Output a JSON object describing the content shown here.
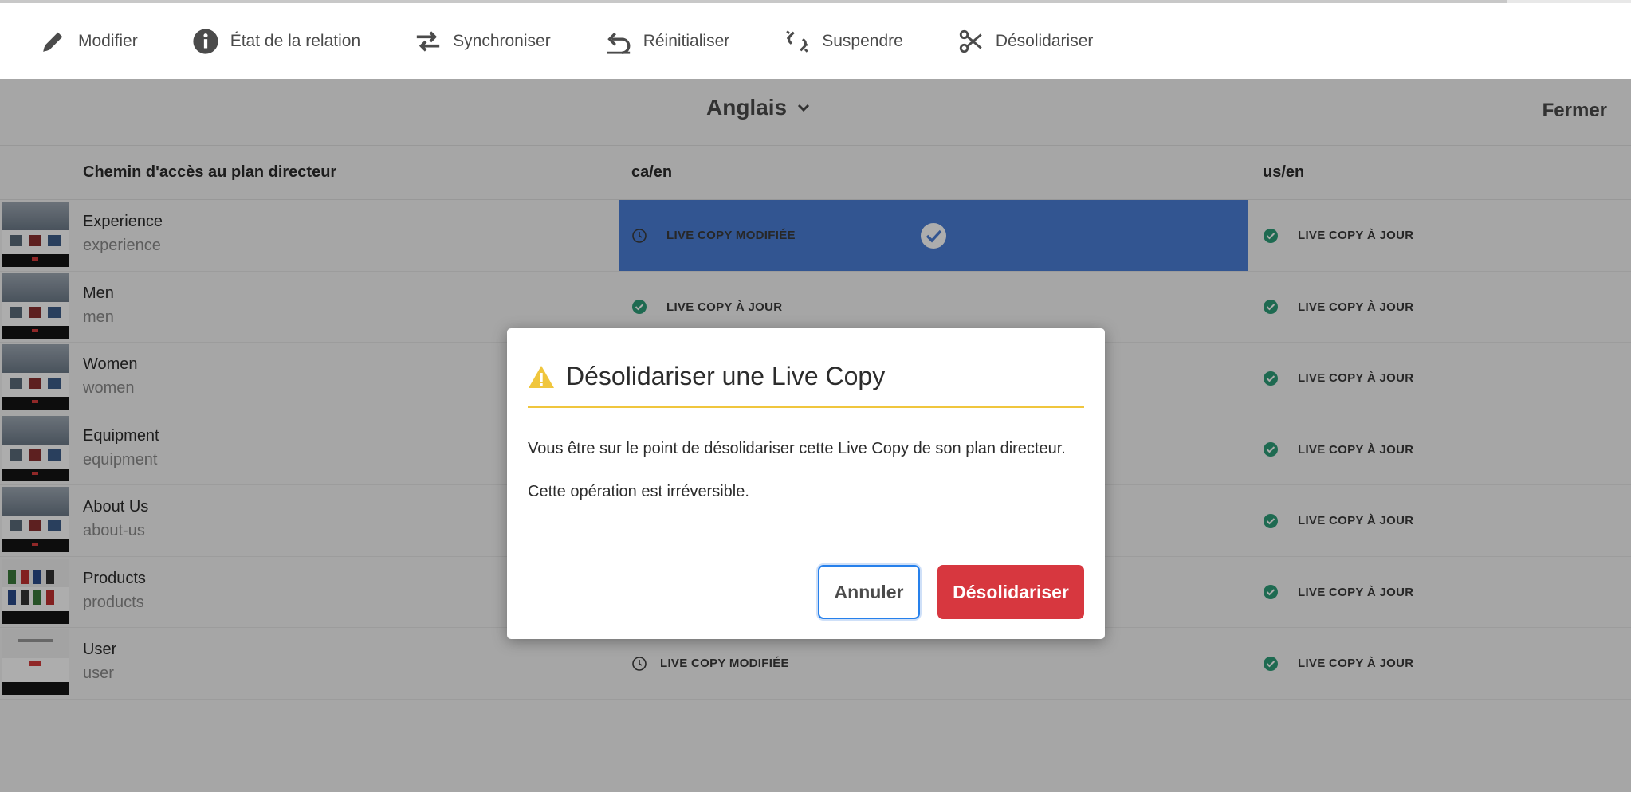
{
  "progress": {
    "percent": 92
  },
  "toolbar": {
    "edit_label": "Modifier",
    "relationship_status_label": "État de la relation",
    "synchronize_label": "Synchroniser",
    "reset_label": "Réinitialiser",
    "suspend_label": "Suspendre",
    "detach_label": "Désolidariser"
  },
  "language_bar": {
    "language": "Anglais",
    "close_label": "Fermer"
  },
  "table": {
    "headers": {
      "blueprint_path": "Chemin d'accès au plan directeur",
      "col_ca": "ca/en",
      "col_us": "us/en"
    },
    "rows": [
      {
        "title": "Experience",
        "path": "experience",
        "ca_status": "LIVE COPY MODIFIÉE",
        "us_status": "LIVE COPY À JOUR"
      },
      {
        "title": "Men",
        "path": "men",
        "ca_status": "LIVE COPY À JOUR",
        "us_status": "LIVE COPY À JOUR"
      },
      {
        "title": "Women",
        "path": "women",
        "ca_status": "",
        "us_status": "LIVE COPY À JOUR"
      },
      {
        "title": "Equipment",
        "path": "equipment",
        "ca_status": "",
        "us_status": "LIVE COPY À JOUR"
      },
      {
        "title": "About Us",
        "path": "about-us",
        "ca_status": "",
        "us_status": "LIVE COPY À JOUR"
      },
      {
        "title": "Products",
        "path": "products",
        "ca_status": "",
        "us_status": "LIVE COPY À JOUR"
      },
      {
        "title": "User",
        "path": "user",
        "ca_status": "LIVE COPY MODIFIÉE",
        "us_status": "LIVE COPY À JOUR"
      }
    ]
  },
  "dialog": {
    "title": "Désolidariser une Live Copy",
    "message": "Vous être sur le point de désolidariser cette Live Copy de son plan directeur.",
    "warning": "Cette opération est irréversible.",
    "cancel_label": "Annuler",
    "confirm_label": "Désolidariser"
  },
  "colors": {
    "accent_blue": "#4b7ed6",
    "success_green": "#2d9d78",
    "danger_red": "#d7373f",
    "warning_yellow": "#f0c63d"
  }
}
